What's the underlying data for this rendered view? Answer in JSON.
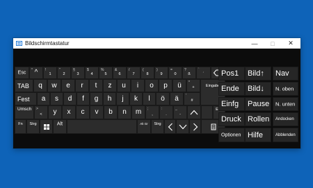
{
  "window": {
    "title": "Bildschirmtastatur",
    "controls": {
      "minimize": "—",
      "maximize": "□",
      "close": "✕"
    }
  },
  "keys": {
    "row1": {
      "esc": "Esc",
      "k1": {
        "main": "1",
        "shift": "!"
      },
      "k2": {
        "main": "2",
        "shift": "\""
      },
      "k3": {
        "main": "3",
        "shift": "§"
      },
      "k4": {
        "main": "4",
        "shift": "$"
      },
      "k5": {
        "main": "5",
        "shift": "%"
      },
      "k6": {
        "main": "6",
        "shift": "&"
      },
      "k7": {
        "main": "7",
        "shift": "/"
      },
      "k8": {
        "main": "8",
        "shift": "("
      },
      "k9": {
        "main": "9",
        "shift": ")"
      },
      "k0": {
        "main": "0",
        "shift": "="
      },
      "ss": {
        "main": "ß",
        "shift": "?"
      },
      "acute": {
        "main": "´",
        "shift": "`"
      },
      "caret": {
        "main": "^",
        "shift": "°"
      },
      "backspace_icon": "backspace-icon"
    },
    "row2": {
      "tab": "TAB",
      "letters": [
        "q",
        "w",
        "e",
        "r",
        "t",
        "z",
        "u",
        "i",
        "o",
        "p",
        "ü"
      ],
      "plus": {
        "main": "+",
        "shift": "*"
      },
      "enter": "Eingabe"
    },
    "row3": {
      "caps": "Fest",
      "letters": [
        "a",
        "s",
        "d",
        "f",
        "g",
        "h",
        "j",
        "k",
        "l",
        "ö",
        "ä"
      ],
      "hash": {
        "main": "#",
        "shift": "'"
      }
    },
    "row4": {
      "shift": "Umsch",
      "lt": {
        "main": "<",
        "shift": ">"
      },
      "letters": [
        "y",
        "x",
        "c",
        "v",
        "b",
        "n",
        "m"
      ],
      "comma": {
        "main": ",",
        "shift": ";"
      },
      "period": {
        "main": ".",
        "shift": ":"
      },
      "minus": {
        "main": "-",
        "shift": "_"
      },
      "del": "Entf"
    },
    "row5": {
      "fn": "Fn",
      "ctrl": "Strg",
      "alt": "Alt",
      "altgr": "Alt Gr",
      "ctrl_right": "Strg"
    },
    "nav": {
      "pos1": "Pos1",
      "bild_up": "Bild↑",
      "nav": "Nav",
      "ende": "Ende",
      "bild_down": "Bild↓",
      "n_oben": "N. oben",
      "einfg": "Einfg",
      "pause": "Pause",
      "n_unten": "N. unten",
      "druck": "Druck",
      "rollen": "Rollen",
      "andocken": "Andocken",
      "optionen": "Optionen",
      "hilfe": "Hilfe",
      "abblenden": "Abblenden"
    }
  }
}
